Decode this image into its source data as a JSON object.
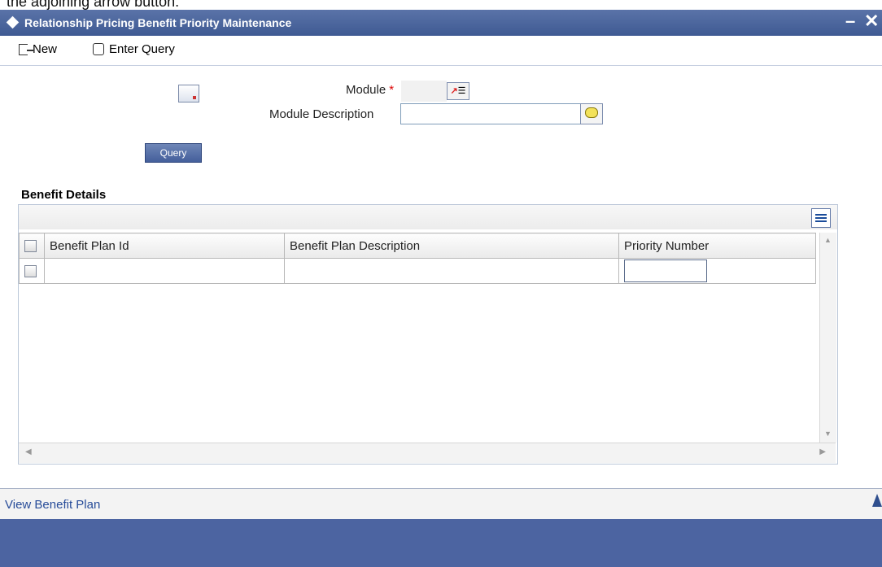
{
  "clipped_text": "the adjoining arrow button.",
  "window": {
    "title": "Relationship Pricing Benefit Priority Maintenance",
    "controls": [
      "–",
      "✕"
    ]
  },
  "toolbar": {
    "new_label": "New",
    "enter_query_label": "Enter Query"
  },
  "form": {
    "module_label": "Module",
    "module_required_mark": "*",
    "module_value": "",
    "module_description_label": "Module Description",
    "module_description_value": "",
    "query_button": "Query"
  },
  "benefit_details": {
    "section_title": "Benefit Details",
    "columns": [
      "Benefit Plan Id",
      "Benefit Plan Description",
      "Priority Number"
    ],
    "rows": [
      {
        "benefit_plan_id": "",
        "benefit_plan_description": "",
        "priority_number": ""
      }
    ]
  },
  "footer": {
    "link": "View Benefit Plan"
  },
  "colors": {
    "title_bar": "#3f5a93",
    "footer": "#4c64a1",
    "link": "#274c99",
    "required": "#d00000"
  }
}
